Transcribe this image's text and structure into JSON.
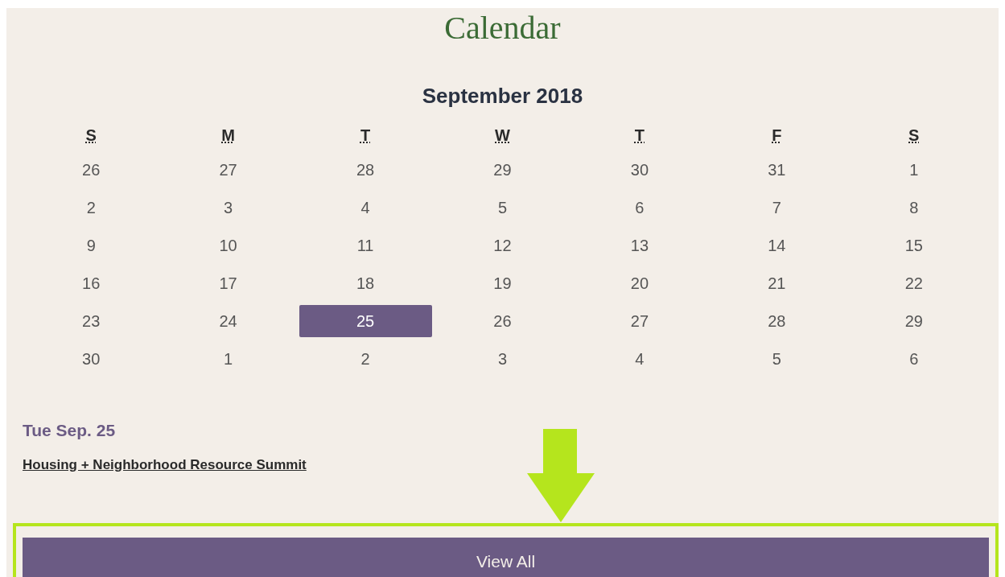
{
  "title": "Calendar",
  "month": "September 2018",
  "weekdays": [
    "S",
    "M",
    "T",
    "W",
    "T",
    "F",
    "S"
  ],
  "weeks": [
    [
      {
        "day": "26",
        "selected": false
      },
      {
        "day": "27",
        "selected": false
      },
      {
        "day": "28",
        "selected": false
      },
      {
        "day": "29",
        "selected": false
      },
      {
        "day": "30",
        "selected": false
      },
      {
        "day": "31",
        "selected": false
      },
      {
        "day": "1",
        "selected": false
      }
    ],
    [
      {
        "day": "2",
        "selected": false
      },
      {
        "day": "3",
        "selected": false
      },
      {
        "day": "4",
        "selected": false
      },
      {
        "day": "5",
        "selected": false
      },
      {
        "day": "6",
        "selected": false
      },
      {
        "day": "7",
        "selected": false
      },
      {
        "day": "8",
        "selected": false
      }
    ],
    [
      {
        "day": "9",
        "selected": false
      },
      {
        "day": "10",
        "selected": false
      },
      {
        "day": "11",
        "selected": false
      },
      {
        "day": "12",
        "selected": false
      },
      {
        "day": "13",
        "selected": false
      },
      {
        "day": "14",
        "selected": false
      },
      {
        "day": "15",
        "selected": false
      }
    ],
    [
      {
        "day": "16",
        "selected": false
      },
      {
        "day": "17",
        "selected": false
      },
      {
        "day": "18",
        "selected": false
      },
      {
        "day": "19",
        "selected": false
      },
      {
        "day": "20",
        "selected": false
      },
      {
        "day": "21",
        "selected": false
      },
      {
        "day": "22",
        "selected": false
      }
    ],
    [
      {
        "day": "23",
        "selected": false
      },
      {
        "day": "24",
        "selected": false
      },
      {
        "day": "25",
        "selected": true
      },
      {
        "day": "26",
        "selected": false
      },
      {
        "day": "27",
        "selected": false
      },
      {
        "day": "28",
        "selected": false
      },
      {
        "day": "29",
        "selected": false
      }
    ],
    [
      {
        "day": "30",
        "selected": false
      },
      {
        "day": "1",
        "selected": false
      },
      {
        "day": "2",
        "selected": false
      },
      {
        "day": "3",
        "selected": false
      },
      {
        "day": "4",
        "selected": false
      },
      {
        "day": "5",
        "selected": false
      },
      {
        "day": "6",
        "selected": false
      }
    ]
  ],
  "event_date": "Tue Sep. 25",
  "event_link": "Housing + Neighborhood Resource Summit",
  "button": "View All"
}
